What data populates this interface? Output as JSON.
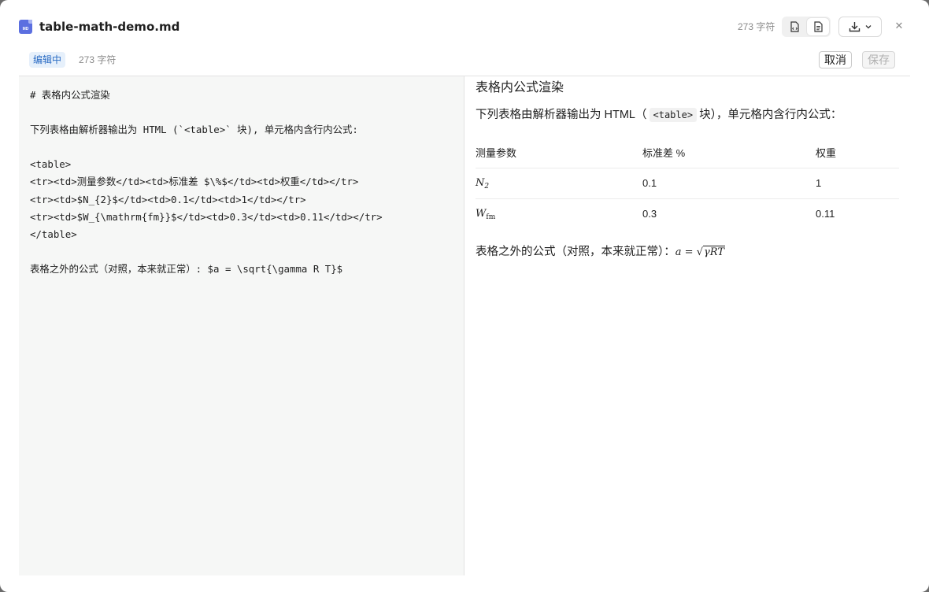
{
  "header": {
    "file_icon_text": "MD",
    "file_name": "table-math-demo.md",
    "char_count": "273 字符"
  },
  "toolbar": {
    "status": "编辑中",
    "char_count": "273 字符",
    "cancel_label": "取消",
    "save_label": "保存"
  },
  "editor": {
    "lines": [
      "# 表格内公式渲染",
      "",
      "下列表格由解析器输出为 HTML (`<table>` 块), 单元格内含行内公式:",
      "",
      "<table>",
      "<tr><td>测量参数</td><td>标准差 $\\%$</td><td>权重</td></tr>",
      "<tr><td>$N_{2}$</td><td>0.1</td><td>1</td></tr>",
      "<tr><td>$W_{\\mathrm{fm}}$</td><td>0.3</td><td>0.11</td></tr>",
      "</table>",
      "",
      "表格之外的公式（对照，本来就正常）: $a = \\sqrt{\\gamma R T}$"
    ]
  },
  "preview": {
    "title": "表格内公式渲染",
    "para_before": "下列表格由解析器输出为 HTML（",
    "para_code": "<table>",
    "para_after": "块），单元格内含行内公式：",
    "table": {
      "header": [
        "测量参数",
        "标准差 %",
        "权重"
      ],
      "rows": [
        {
          "sym": "N",
          "sub": "2",
          "std": "0.1",
          "weight": "1"
        },
        {
          "sym": "W",
          "sub": "fm",
          "std": "0.3",
          "weight": "0.11"
        }
      ]
    },
    "formula_prefix": "表格之外的公式（对照，本来就正常）：",
    "formula_lhs": "a",
    "formula_eq": "=",
    "formula_radicand": "γRT"
  },
  "colors": {
    "accent": "#5b6fe0",
    "status_bg": "#e6f0fb",
    "status_text": "#2b6cc4",
    "editor_bg": "#f6f7f6"
  }
}
